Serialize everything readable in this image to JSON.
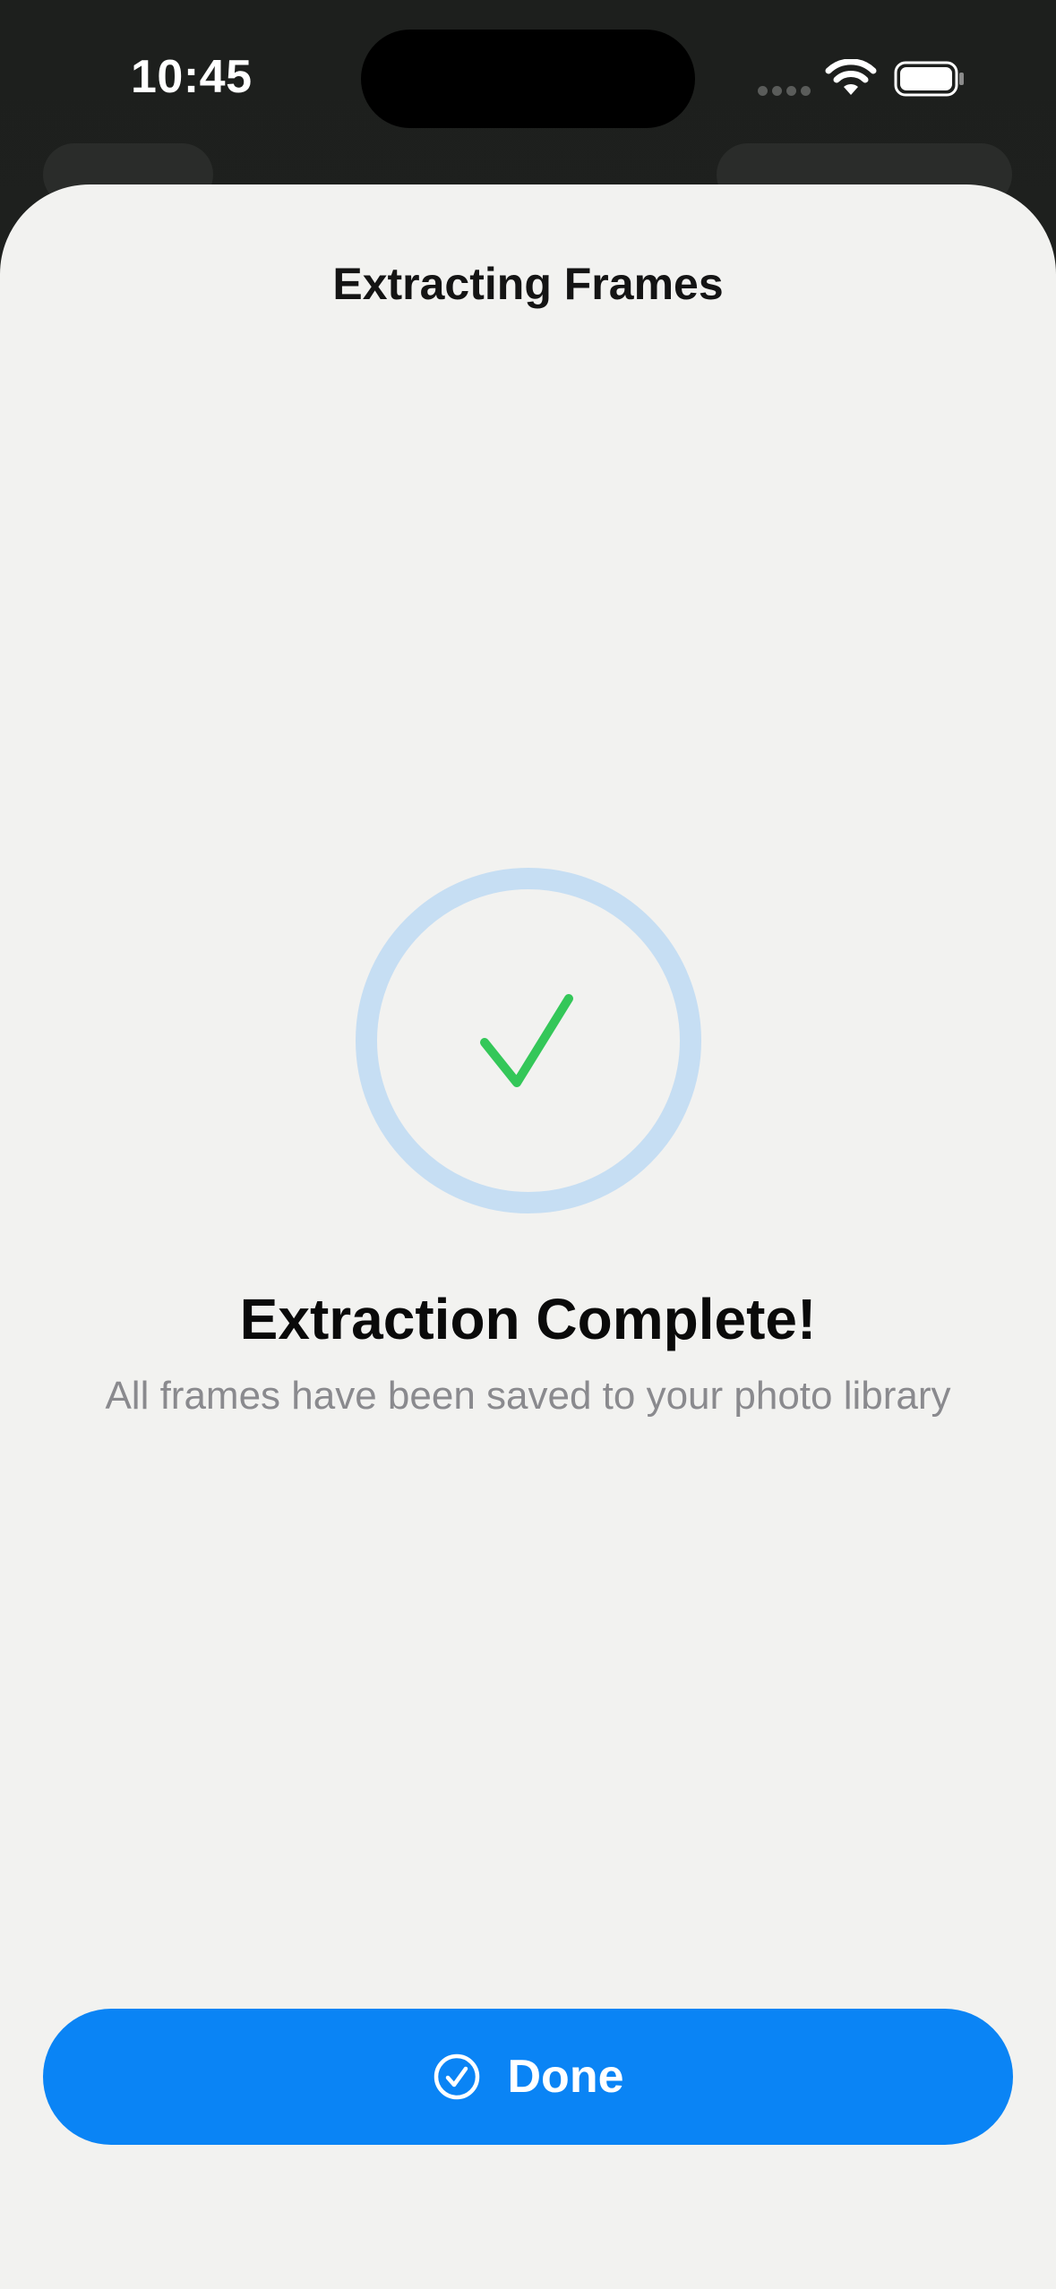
{
  "status_bar": {
    "time": "10:45",
    "icons": [
      "cellular-signal-icon",
      "wifi-icon",
      "battery-icon"
    ]
  },
  "sheet": {
    "title": "Extracting Frames",
    "result": {
      "icon": "checkmark-icon",
      "title": "Extraction Complete!",
      "subtitle": "All frames have been saved to your photo library"
    },
    "done_button": {
      "icon": "checkmark-circle-icon",
      "label": "Done"
    }
  },
  "colors": {
    "accent": "#0a84f5",
    "success": "#34c759",
    "ring": "#c6def3",
    "sheet_background": "#f2f2f0"
  }
}
